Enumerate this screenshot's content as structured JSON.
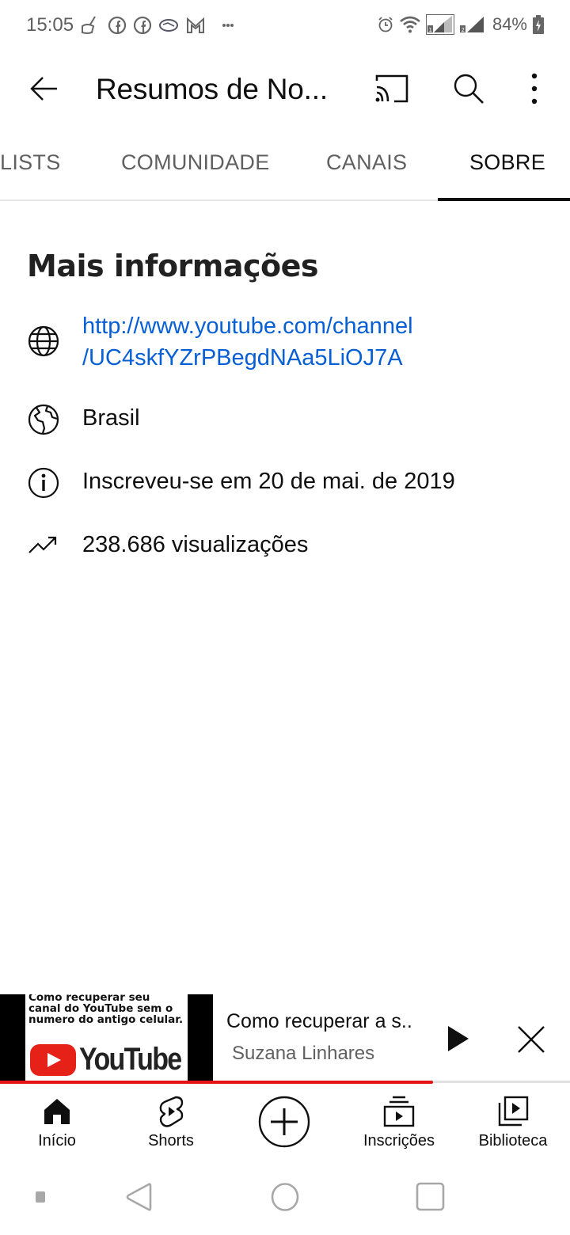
{
  "status_bar": {
    "time": "15:05",
    "notification_icons": [
      "cleaner-icon",
      "facebook-icon",
      "facebook-icon",
      "handshake-app-icon",
      "gmail-icon",
      "more-notifications-icon"
    ],
    "system_icons": [
      "alarm-icon",
      "wifi-icon",
      "sim1-signal-icon",
      "sim2-signal-icon"
    ],
    "battery_percent": "84%"
  },
  "app_bar": {
    "title": "Resumos de No...",
    "actions": [
      "cast-icon",
      "search-icon",
      "more-vert-icon"
    ]
  },
  "tabs": {
    "items": [
      {
        "label": "LISTS",
        "active": false
      },
      {
        "label": "COMUNIDADE",
        "active": false
      },
      {
        "label": "CANAIS",
        "active": false
      },
      {
        "label": "SOBRE",
        "active": true
      }
    ]
  },
  "about": {
    "section_title": "Mais informações",
    "link_line1": "http://www.youtube.com/channel",
    "link_line2": "/UC4skfYZrPBegdNAa5LiOJ7A",
    "country": "Brasil",
    "joined": "Inscreveu-se em 20 de mai. de 2019",
    "views": "238.686 visualizações"
  },
  "mini_player": {
    "thumbnail_text": [
      "Como recuperar seu",
      "canal do YouTube sem o",
      "numero do antigo celular."
    ],
    "thumbnail_logo_text": "YouTube",
    "title": "Como recuperar a s..",
    "channel": "Suzana Linhares",
    "progress_percent": 76,
    "colors": {
      "progress": "#e31416"
    }
  },
  "bottom_nav": {
    "items": [
      {
        "label": "Início",
        "icon": "home-icon"
      },
      {
        "label": "Shorts",
        "icon": "shorts-icon"
      },
      {
        "label": "",
        "icon": "create-icon"
      },
      {
        "label": "Inscrições",
        "icon": "subscriptions-icon"
      },
      {
        "label": "Biblioteca",
        "icon": "library-icon"
      }
    ]
  },
  "colors": {
    "link": "#065fd4",
    "tab_inactive": "#606060",
    "text": "#0f0f0f"
  }
}
